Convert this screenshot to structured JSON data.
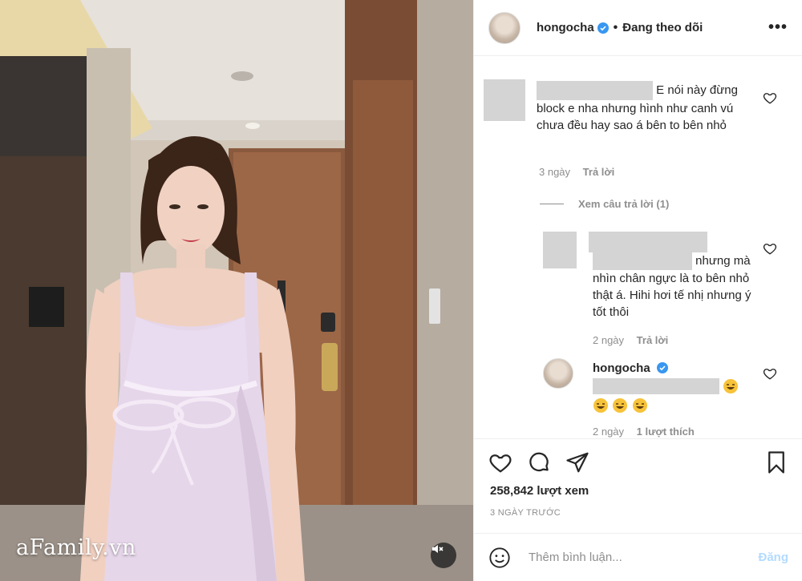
{
  "watermark": "aFamily.vn",
  "post": {
    "username": "hongocha",
    "separator": "•",
    "follow_status": "Đang theo dõi",
    "more_label": "•••"
  },
  "comments": {
    "c1": {
      "text_line1": "E nói này đừng",
      "text_rest": "block e nha nhưng hình như canh vú chưa đều hay sao á bên to bên nhỏ",
      "time": "3 ngày",
      "reply": "Trả lời"
    },
    "view_replies": "Xem câu trả lời (1)",
    "r1": {
      "text_line2": "nhưng",
      "text_rest": "mà nhìn chân ngực là to bên nhỏ thật á. Hihi hơi tế nhị nhưng ý tốt thôi",
      "time": "2 ngày",
      "reply": "Trả lời"
    },
    "r2": {
      "username": "hongocha",
      "time": "2 ngày",
      "likes": "1 lượt thích"
    }
  },
  "stats": {
    "views": "258,842 lượt xem",
    "posted_ago": "3 NGÀY TRƯỚC"
  },
  "comment_box": {
    "placeholder": "Thêm bình luận...",
    "post_label": "Đăng"
  },
  "colors": {
    "verified": "#3897f0",
    "post_disabled": "#b3dbff",
    "muted_text": "#8e8e8e"
  }
}
